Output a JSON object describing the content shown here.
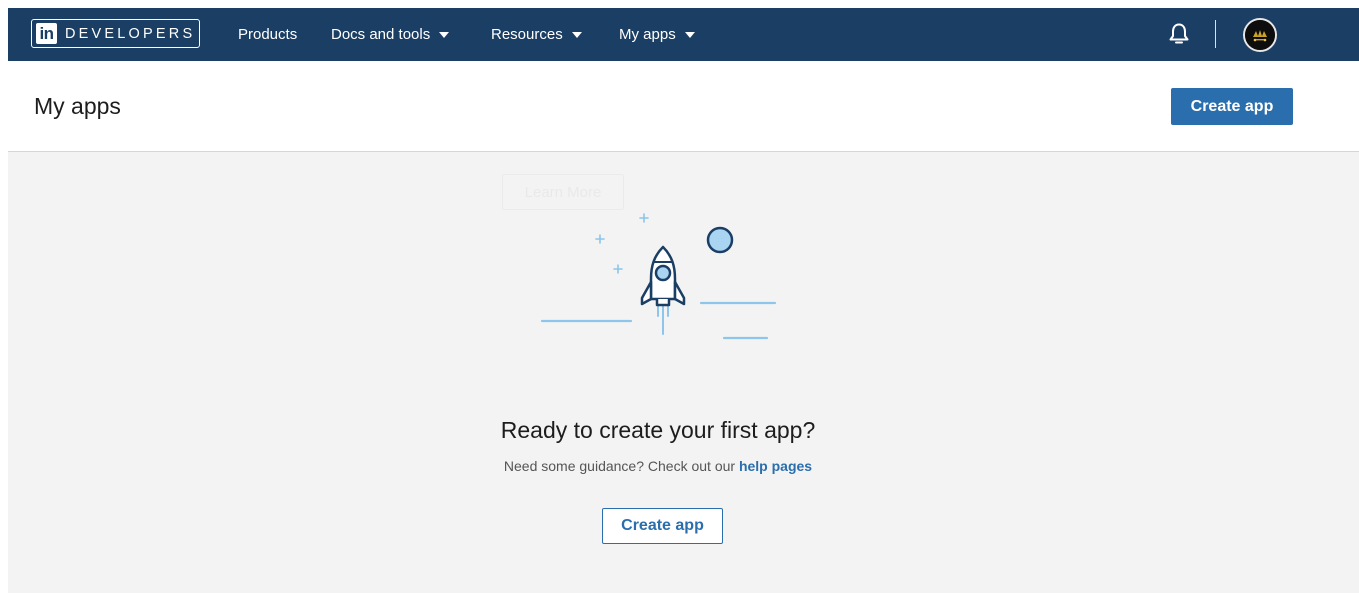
{
  "topnav": {
    "logo_mark": "in",
    "logo_text": "DEVELOPERS",
    "items": [
      {
        "label": "Products",
        "has_dropdown": false
      },
      {
        "label": "Docs and tools",
        "has_dropdown": true
      },
      {
        "label": "Resources",
        "has_dropdown": true
      },
      {
        "label": "My apps",
        "has_dropdown": true
      }
    ],
    "bell_icon": "bell-icon",
    "avatar_icon": "user-avatar"
  },
  "header": {
    "title": "My apps",
    "create_label": "Create app"
  },
  "empty_state": {
    "ghost_label": "Learn More",
    "illustration": "rocket-launch-illustration",
    "title": "Ready to create your first app?",
    "subtitle_prefix": "Need some guidance? Check out our",
    "subtitle_link": "help pages",
    "create_label": "Create app"
  },
  "colors": {
    "nav_bg": "#1b3e64",
    "accent": "#2a6ead",
    "page_bg": "#f3f3f3",
    "illustration_stroke": "#1b3e64",
    "illustration_light": "#8ec5ea"
  }
}
